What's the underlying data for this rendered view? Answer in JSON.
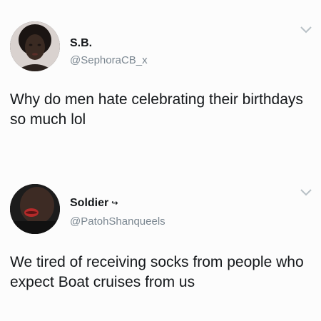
{
  "tweets": [
    {
      "display_name": "S.B.",
      "handle": "@SephoraCB_x",
      "text": "Why do men hate celebrating their birthdays so much lol",
      "avatar_icon": "user-avatar-icon",
      "menu_icon": "chevron-down-icon"
    },
    {
      "display_name": "Soldier",
      "name_badge": "↪",
      "handle": "@PatohShanqueels",
      "text": "We tired of receiving socks from people who expect Boat cruises from us",
      "avatar_icon": "user-avatar-icon",
      "menu_icon": "chevron-down-icon"
    }
  ],
  "colors": {
    "name": "#14171a",
    "handle": "#7b8791",
    "chevron": "#b8c0c6",
    "background": "#fcfcfc"
  }
}
